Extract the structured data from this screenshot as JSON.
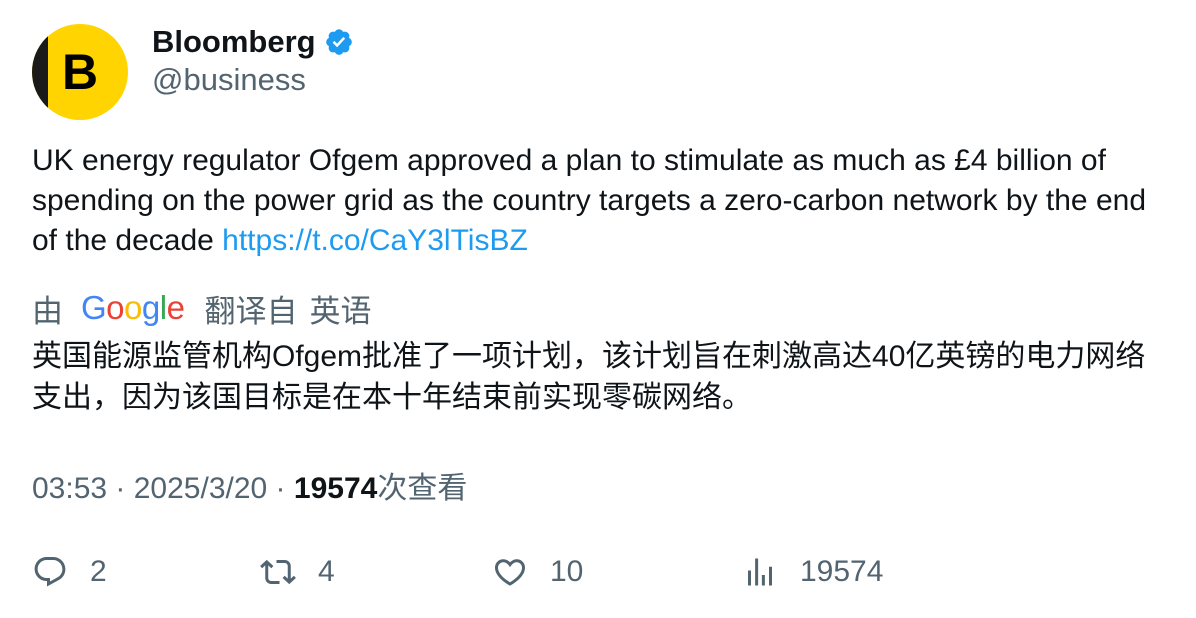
{
  "author": {
    "display_name": "Bloomberg",
    "handle": "@business",
    "avatar_letter": "B",
    "avatar_color": "#ffd400",
    "verified": true,
    "verified_icon": "verified-badge-icon",
    "verified_color": "#1d9bf0"
  },
  "tweet": {
    "text": "UK energy regulator Ofgem approved a plan to stimulate as much as £4 billion of spending on the power grid as the country targets a zero-carbon network by the end of the decade ",
    "link": "https://t.co/CaY3lTisBZ",
    "link_color": "#1d9bf0"
  },
  "translation": {
    "prefix": "由",
    "provider_letters": [
      "G",
      "o",
      "o",
      "g",
      "l",
      "e"
    ],
    "label": "翻译自",
    "language": "英语",
    "text": "英国能源监管机构Ofgem批准了一项计划，该计划旨在刺激高达40亿英镑的电力网络支出，因为该国目标是在本十年结束前实现零碳网络。"
  },
  "meta": {
    "time": "03:53",
    "separator": " · ",
    "date": "2025/3/20",
    "views": "19574",
    "views_label": "次查看"
  },
  "actions": {
    "reply": {
      "icon": "reply-icon",
      "count": "2"
    },
    "retweet": {
      "icon": "retweet-icon",
      "count": "4"
    },
    "like": {
      "icon": "heart-icon",
      "count": "10"
    },
    "views": {
      "icon": "bar-chart-icon",
      "count": "19574"
    }
  },
  "colors": {
    "text_primary": "#0f1419",
    "text_secondary": "#536471",
    "accent": "#1d9bf0"
  }
}
